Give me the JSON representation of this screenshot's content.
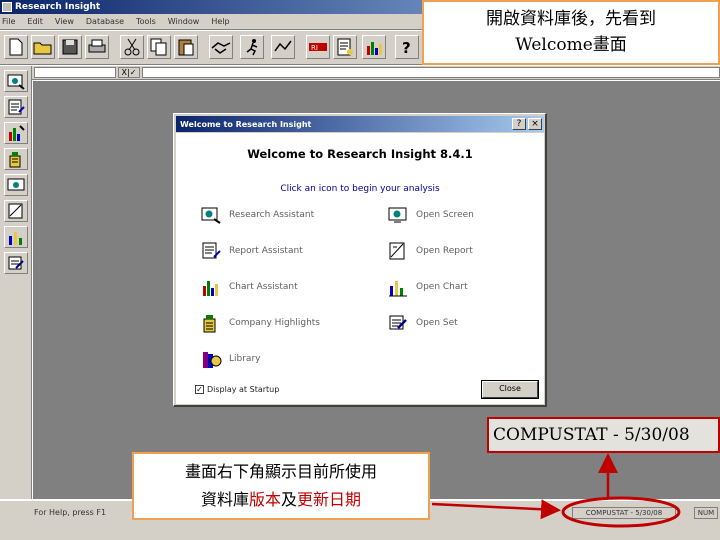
{
  "window": {
    "title": "Research Insight"
  },
  "menu": {
    "items": [
      "File",
      "Edit",
      "View",
      "Database",
      "Tools",
      "Window",
      "Help"
    ]
  },
  "toolbar2": {
    "field_label": "X|✓"
  },
  "dialog": {
    "title": "Welcome to Research Insight",
    "help_btn": "?",
    "close_btn": "×",
    "welcome_text": "Welcome to Research Insight 8.4.1",
    "prompt": "Click an icon to begin your analysis",
    "options_left": [
      {
        "label": "Research Assistant",
        "icon": "research-assistant-icon"
      },
      {
        "label": "Report Assistant",
        "icon": "report-assistant-icon"
      },
      {
        "label": "Chart Assistant",
        "icon": "chart-assistant-icon"
      },
      {
        "label": "Company Highlights",
        "icon": "company-highlights-icon"
      },
      {
        "label": "Library",
        "icon": "library-icon"
      }
    ],
    "options_right": [
      {
        "label": "Open Screen",
        "icon": "open-screen-icon"
      },
      {
        "label": "Open Report",
        "icon": "open-report-icon"
      },
      {
        "label": "Open Chart",
        "icon": "open-chart-icon"
      },
      {
        "label": "Open Set",
        "icon": "open-set-icon"
      }
    ],
    "startup_label": "Display at Startup",
    "startup_checked": "✓",
    "close_label": "Close"
  },
  "status": {
    "help_text": "For Help, press F1",
    "database": "COMPUSTAT - 5/30/08",
    "num": "NUM"
  },
  "annotations": {
    "top_line1": "開啟資料庫後，先看到",
    "top_line2": "Welcome畫面",
    "zoom_text": "COMPUSTAT - 5/30/08",
    "bottom_line1": "畫面右下角顯示目前所使用",
    "bottom_line2_a": "資料庫",
    "bottom_line2_b": "版本",
    "bottom_line2_c": "及",
    "bottom_line2_d": "更新日期"
  },
  "colors": {
    "accent": "#f0a050",
    "highlight": "#c00000",
    "workspace": "#808080"
  }
}
